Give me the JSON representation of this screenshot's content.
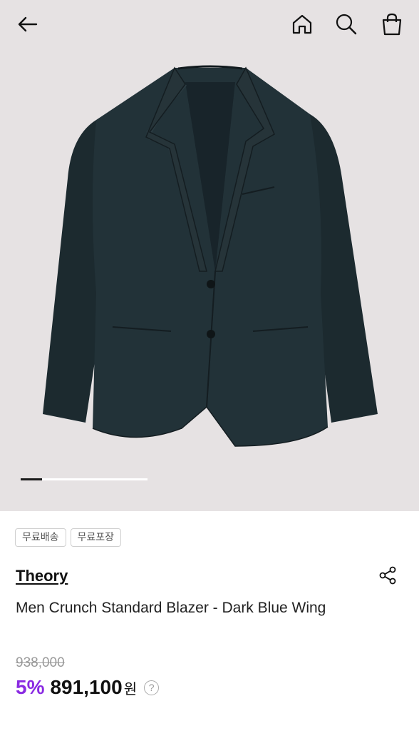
{
  "header": {
    "icons": [
      "back-arrow-icon",
      "home-icon",
      "search-icon",
      "shopping-bag-icon"
    ]
  },
  "gallery": {
    "progress_fraction": 0.17,
    "image_subject": "dark navy blazer"
  },
  "tags": [
    "무료배송",
    "무료포장"
  ],
  "product": {
    "brand": "Theory",
    "title": "Men Crunch Standard Blazer - Dark Blue Wing",
    "original_price": "938,000",
    "discount": "5%",
    "price": "891,100",
    "currency": "원",
    "help_symbol": "?"
  },
  "colors": {
    "hero_bg": "#e6e2e3",
    "discount": "#8a2be2",
    "blazer": "#1f2c31"
  }
}
